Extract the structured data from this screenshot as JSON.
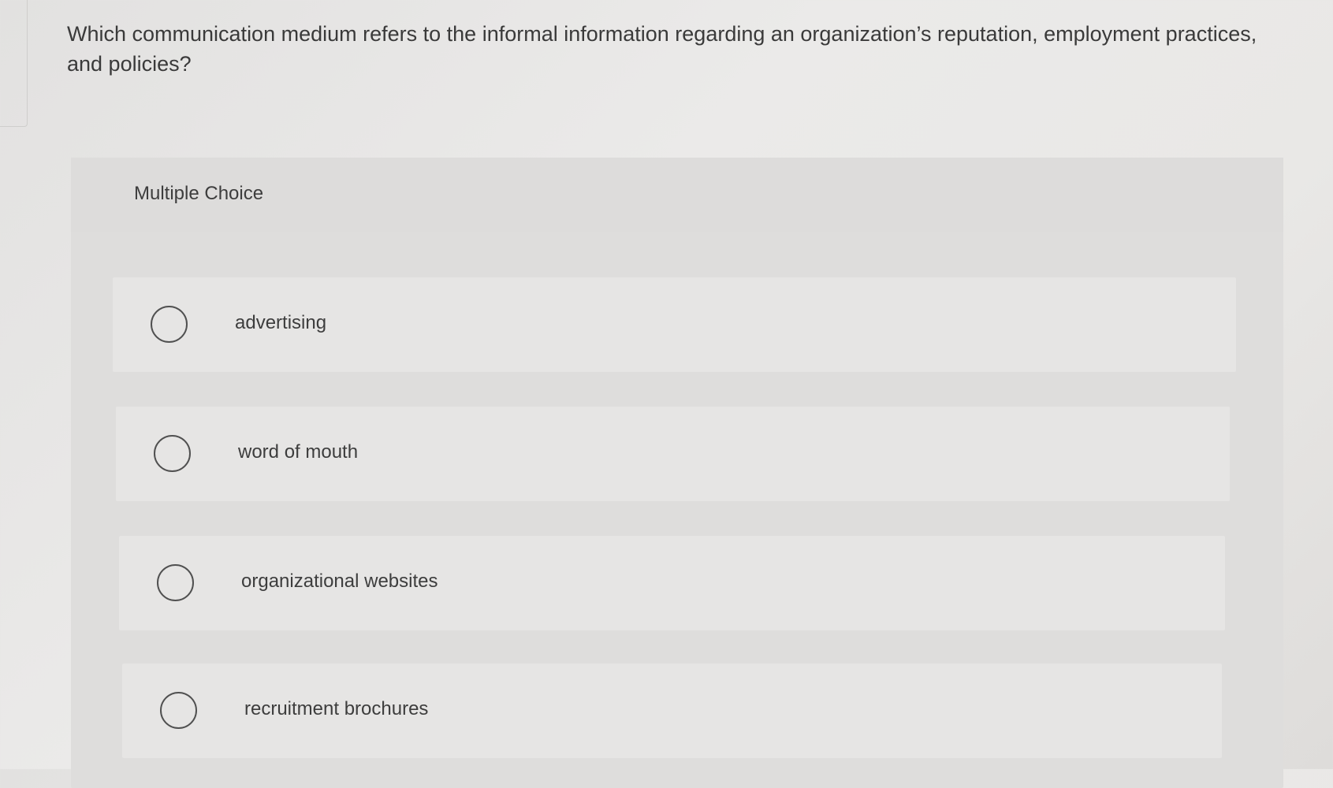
{
  "question": {
    "text": "Which communication medium refers to the informal information regarding an organization’s reputation, employment practices, and policies?"
  },
  "multiple_choice": {
    "label": "Multiple Choice",
    "options": [
      {
        "label": "advertising",
        "selected": false
      },
      {
        "label": "word of mouth",
        "selected": false
      },
      {
        "label": "organizational websites",
        "selected": false
      },
      {
        "label": "recruitment brochures",
        "selected": false
      }
    ]
  }
}
